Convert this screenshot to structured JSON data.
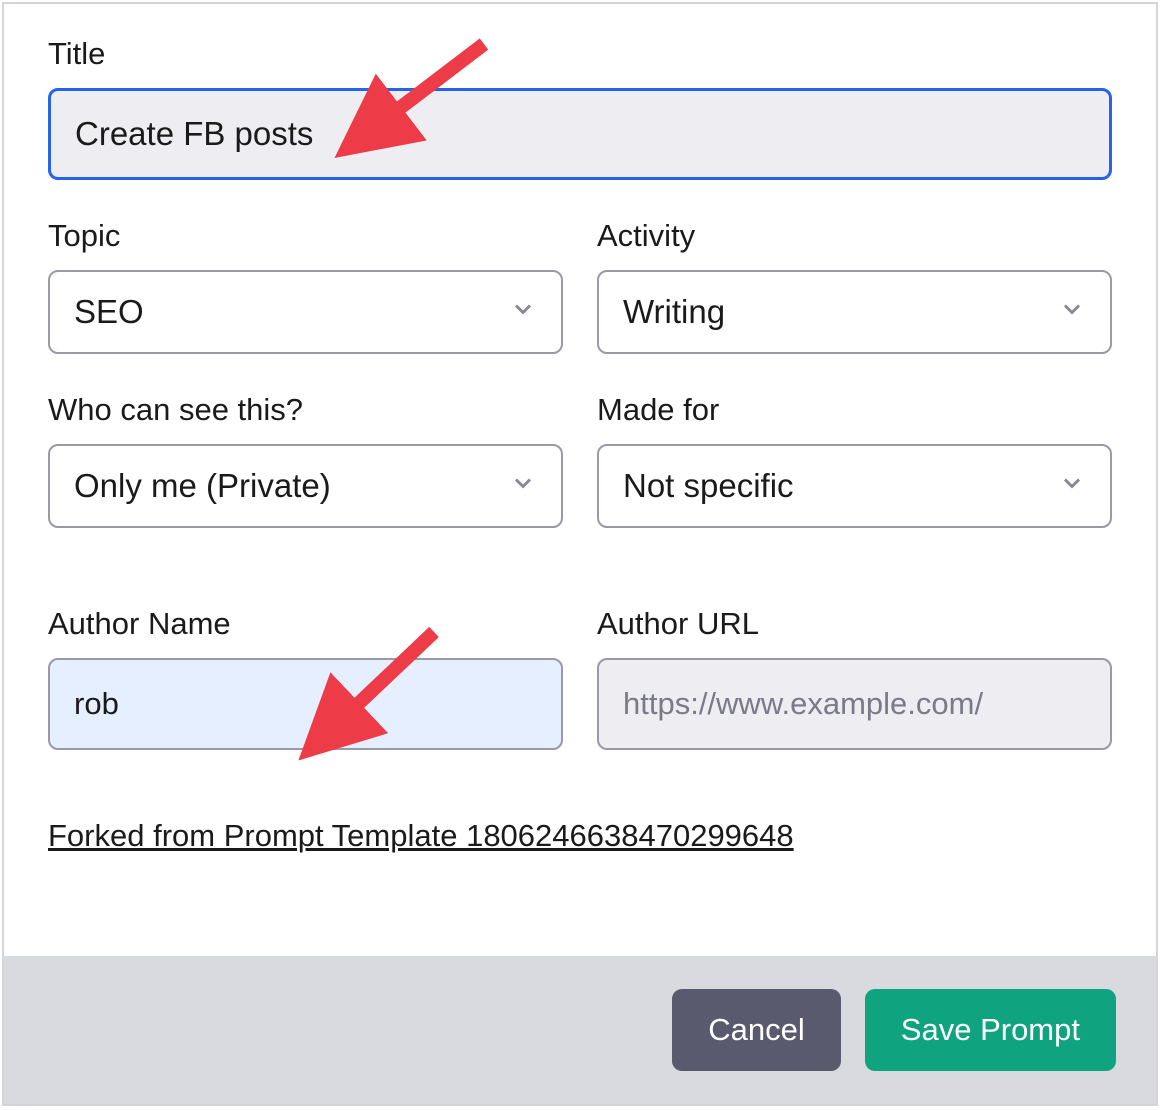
{
  "form": {
    "title": {
      "label": "Title",
      "value": "Create FB posts"
    },
    "topic": {
      "label": "Topic",
      "value": "SEO"
    },
    "activity": {
      "label": "Activity",
      "value": "Writing"
    },
    "visibility": {
      "label": "Who can see this?",
      "value": "Only me (Private)"
    },
    "made_for": {
      "label": "Made for",
      "value": "Not specific"
    },
    "author_name": {
      "label": "Author Name",
      "value": "rob"
    },
    "author_url": {
      "label": "Author URL",
      "placeholder": "https://www.example.com/"
    },
    "forked_link": "Forked from Prompt Template 1806246638470299648"
  },
  "footer": {
    "cancel": "Cancel",
    "save": "Save Prompt"
  },
  "annotation": {
    "arrow_color": "#ed3b47"
  }
}
